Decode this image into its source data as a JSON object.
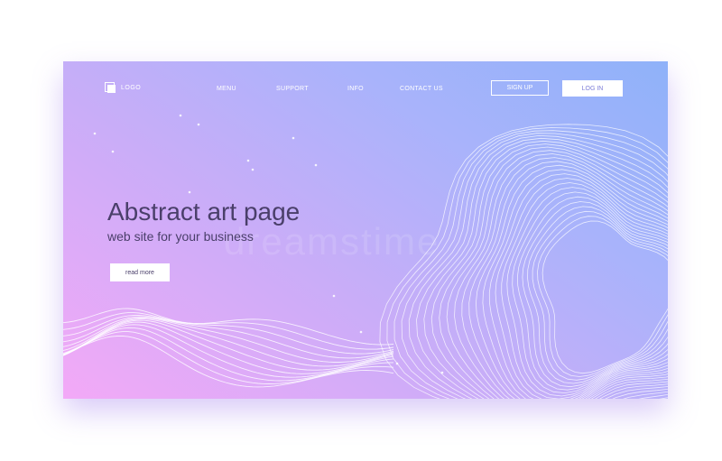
{
  "colors": {
    "gradient_start": "#f3a9f7",
    "gradient_end": "#8fb2f9",
    "text_dark": "#4a3f6a",
    "text_light": "#ffffff"
  },
  "header": {
    "logo_label": "LOGO",
    "nav": {
      "menu": "MENU",
      "support": "SUPPORT",
      "info": "INFO",
      "contact": "CONTACT US"
    },
    "sign_up": "SIGN UP",
    "log_in": "LOG IN"
  },
  "hero": {
    "title": "Abstract art page",
    "subtitle": "web site for your business",
    "cta": "read more"
  },
  "watermark": "dreamstime"
}
